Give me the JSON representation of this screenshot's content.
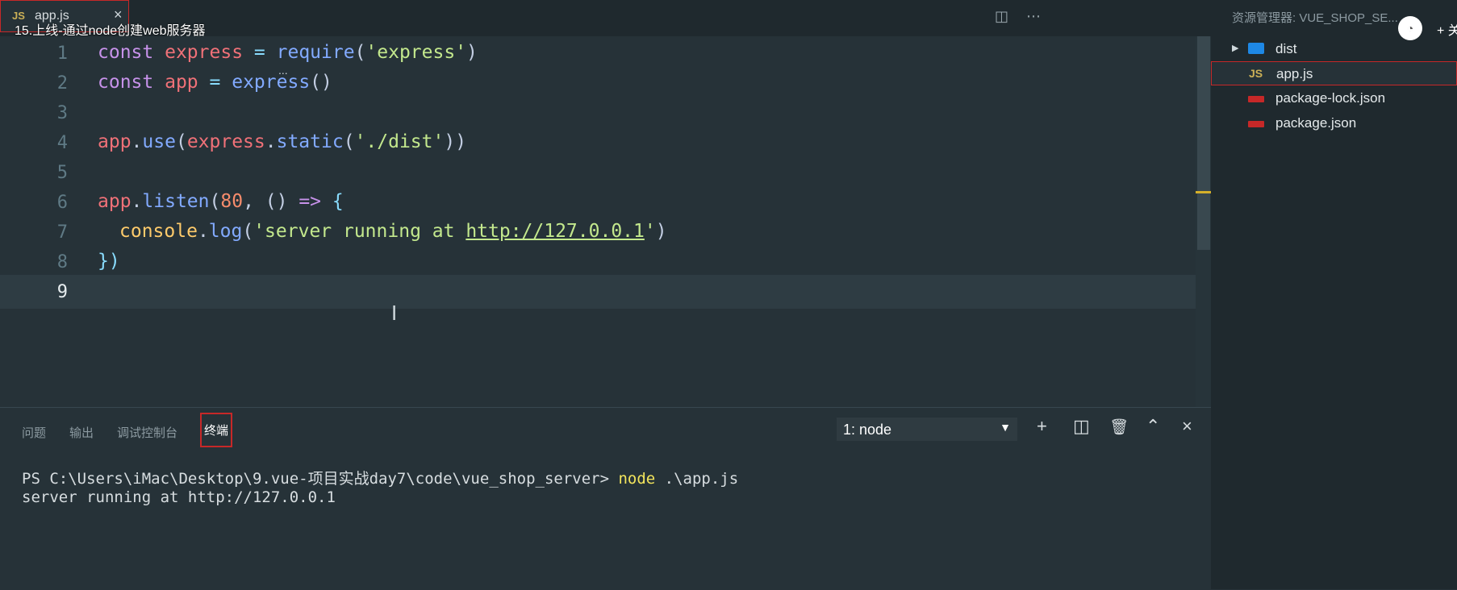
{
  "tab": {
    "icon": "JS",
    "filename": "app.js",
    "close": "×"
  },
  "video_title": "15.上线-通过node创建web服务器",
  "editor": {
    "lines": [
      {
        "n": "1"
      },
      {
        "n": "2"
      },
      {
        "n": "3"
      },
      {
        "n": "4"
      },
      {
        "n": "5"
      },
      {
        "n": "6"
      },
      {
        "n": "7"
      },
      {
        "n": "8"
      },
      {
        "n": "9"
      }
    ],
    "code": {
      "l1": [
        "const",
        "express",
        "=",
        "require",
        "(",
        "'express'",
        ")"
      ],
      "l2": [
        "const",
        "app",
        "=",
        "express",
        "()"
      ],
      "l4": [
        "app",
        ".",
        "use",
        "(",
        "express",
        ".",
        "static",
        "(",
        "'./dist'",
        "))"
      ],
      "l6": [
        "app",
        ".",
        "listen",
        "(",
        "80",
        ", ",
        "()",
        " => ",
        "{"
      ],
      "l7": [
        "console",
        ".",
        "log",
        "(",
        "'server running at ",
        "http://127.0.0.1",
        "'",
        ")"
      ],
      "l8": [
        "})"
      ]
    },
    "cursor_glyph": "I",
    "overflow_dots": "..."
  },
  "panel": {
    "tabs": [
      "问题",
      "输出",
      "调试控制台",
      "终端"
    ],
    "terminal_selected": "1: node",
    "terminal_lines": {
      "prompt": "PS C:\\Users\\iMac\\Desktop\\9.vue-项目实战day7\\code\\vue_shop_server> ",
      "command": "node",
      "args": " .\\app.js",
      "output": "server running at http://127.0.0.1"
    },
    "icons": [
      "+",
      "◫",
      "🗑",
      "⌃",
      "×"
    ]
  },
  "sidebar": {
    "title": "资源管理器: VUE_SHOP_SE...",
    "right_text": "+ 关",
    "items": [
      {
        "label": "dist",
        "kind": "folder"
      },
      {
        "label": "app.js",
        "kind": "js"
      },
      {
        "label": "package-lock.json",
        "kind": "npm"
      },
      {
        "label": "package.json",
        "kind": "npm"
      }
    ]
  },
  "colors": {
    "editor_bg": "#263238",
    "keyword": "#c792ea",
    "variable": "#f07178",
    "function": "#82aaff",
    "string": "#c3e88d",
    "number": "#f78c6c",
    "highlight_border": "#c62828"
  }
}
